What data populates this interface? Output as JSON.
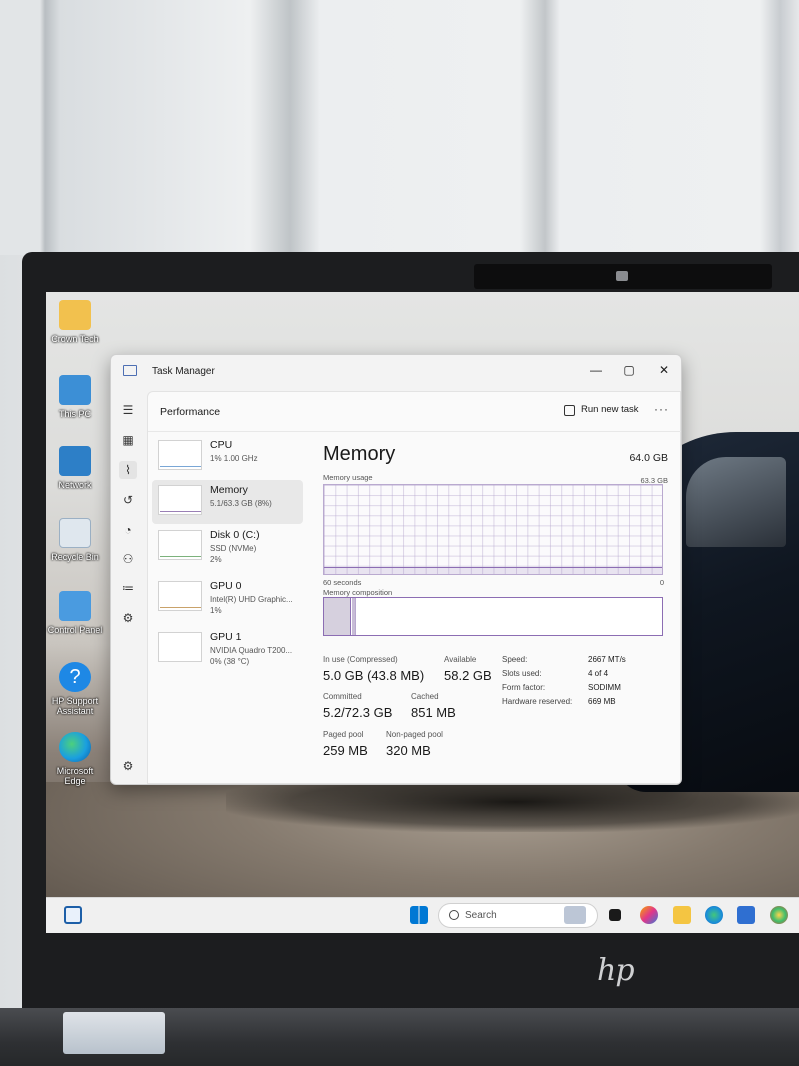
{
  "desktop": {
    "icons": [
      {
        "label": "Crown Tech"
      },
      {
        "label": "This PC"
      },
      {
        "label": "Network"
      },
      {
        "label": "Recycle Bin"
      },
      {
        "label": "Control Panel"
      },
      {
        "label": "HP Support Assistant"
      },
      {
        "label": "Microsoft Edge"
      }
    ]
  },
  "window": {
    "title": "Task Manager",
    "controls": {
      "minimize": "—",
      "maximize": "▢",
      "close": "✕"
    }
  },
  "header": {
    "page_title": "Performance",
    "run_task_label": "Run new task",
    "more_label": "···"
  },
  "nav_icons": [
    "menu-icon",
    "processes-icon",
    "performance-icon",
    "app-history-icon",
    "startup-icon",
    "users-icon",
    "details-icon",
    "services-icon",
    "settings-icon"
  ],
  "sidebar": {
    "items": [
      {
        "name": "CPU",
        "sub1": "1% 1.00 GHz",
        "sub2": ""
      },
      {
        "name": "Memory",
        "sub1": "5.1/63.3 GB (8%)",
        "sub2": ""
      },
      {
        "name": "Disk 0 (C:)",
        "sub1": "SSD (NVMe)",
        "sub2": "2%"
      },
      {
        "name": "GPU 0",
        "sub1": "Intel(R) UHD Graphic...",
        "sub2": "1%"
      },
      {
        "name": "GPU 1",
        "sub1": "NVIDIA Quadro T200...",
        "sub2": "0% (38 °C)"
      }
    ]
  },
  "memory": {
    "title": "Memory",
    "total": "64.0 GB",
    "usage_label": "Memory usage",
    "usage_max": "63.3 GB",
    "time_span": "60 seconds",
    "time_end": "0",
    "composition_label": "Memory composition",
    "usage_fraction": 0.08,
    "stats": {
      "in_use_label": "In use (Compressed)",
      "in_use_value": "5.0 GB (43.8 MB)",
      "available_label": "Available",
      "available_value": "58.2 GB",
      "committed_label": "Committed",
      "committed_value": "5.2/72.3 GB",
      "cached_label": "Cached",
      "cached_value": "851 MB",
      "paged_label": "Paged pool",
      "paged_value": "259 MB",
      "nonpaged_label": "Non-paged pool",
      "nonpaged_value": "320 MB"
    },
    "specs": [
      {
        "label": "Speed:",
        "value": "2667 MT/s"
      },
      {
        "label": "Slots used:",
        "value": "4 of 4"
      },
      {
        "label": "Form factor:",
        "value": "SODIMM"
      },
      {
        "label": "Hardware reserved:",
        "value": "669 MB"
      }
    ]
  },
  "taskbar": {
    "search_placeholder": "Search"
  },
  "brand": {
    "laptop_logo": "hp"
  },
  "colors": {
    "accent": "#005fb8",
    "memory_graph": "#8c6db3"
  }
}
